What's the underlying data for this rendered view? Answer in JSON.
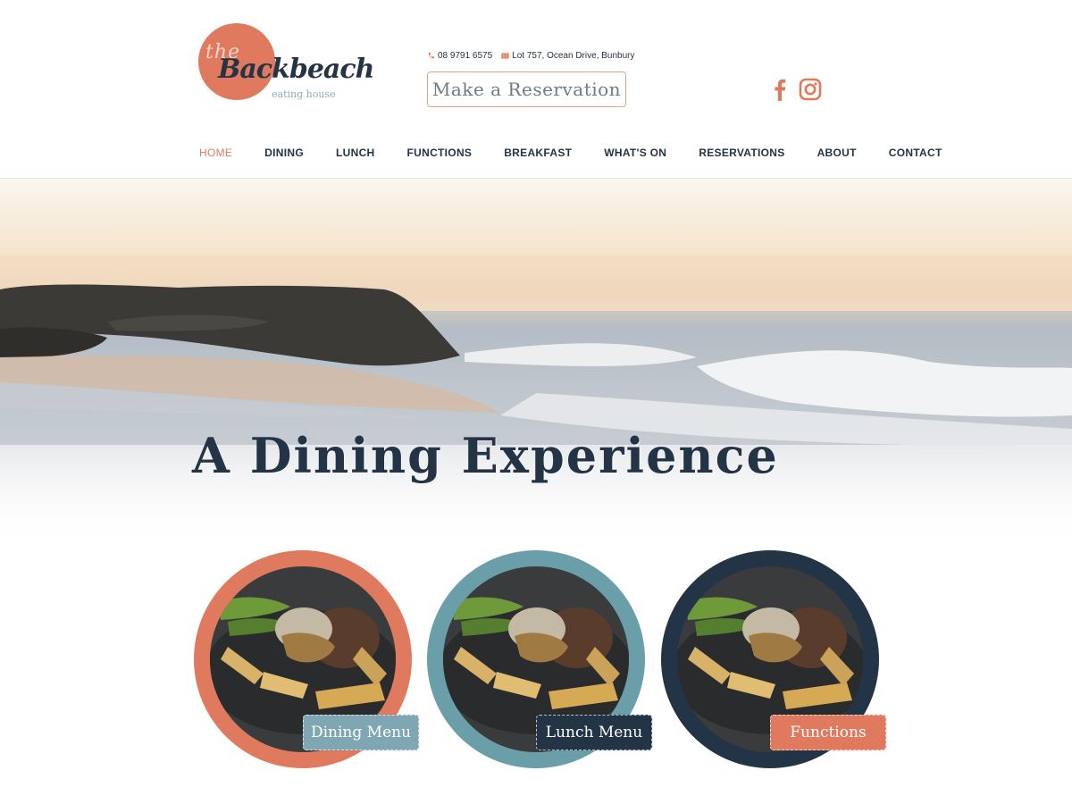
{
  "brand": {
    "logo_the": "the",
    "logo_name": "Backbeach",
    "logo_sub": "eating house"
  },
  "contact": {
    "phone": "08 9791 6575",
    "address": "Lot 757, Ocean Drive, Bunbury"
  },
  "reservation_button": "Make a Reservation",
  "social": {
    "facebook_icon": "facebook-icon",
    "instagram_icon": "instagram-icon"
  },
  "nav": {
    "items": [
      {
        "label": "HOME",
        "active": true
      },
      {
        "label": "DINING"
      },
      {
        "label": "LUNCH"
      },
      {
        "label": "FUNCTIONS"
      },
      {
        "label": "BREAKFAST"
      },
      {
        "label": "WHAT'S ON"
      },
      {
        "label": "RESERVATIONS"
      },
      {
        "label": "ABOUT"
      },
      {
        "label": "CONTACT"
      }
    ]
  },
  "hero": {
    "title": "A Dining Experience"
  },
  "cards": [
    {
      "button": "Dining Menu",
      "ring_color": "#e07a5f",
      "button_color": "#7fa6b3"
    },
    {
      "button": "Lunch Menu",
      "ring_color": "#6a9faa",
      "button_color": "#243447"
    },
    {
      "button": "Functions",
      "ring_color": "#243447",
      "button_color": "#e07a5f"
    }
  ],
  "colors": {
    "accent": "#e07a5f",
    "teal": "#6a9faa",
    "navy": "#243447"
  }
}
